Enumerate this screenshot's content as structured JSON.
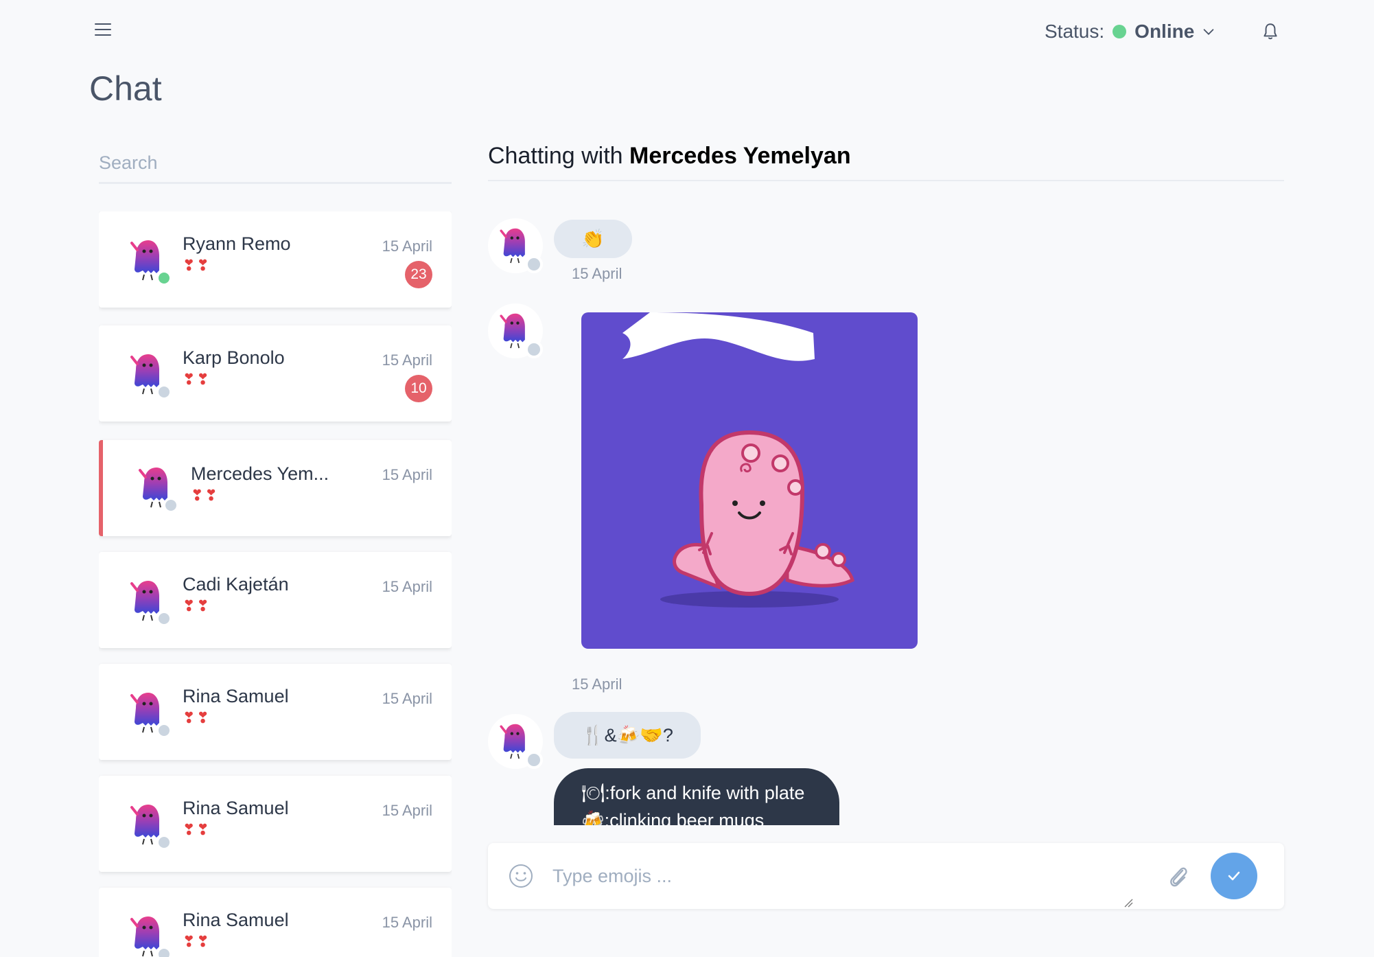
{
  "header": {
    "menu_icon": "hamburger-icon",
    "status_label": "Status:",
    "status_value": "Online",
    "status_color": "#68d391",
    "bell_icon": "bell-icon"
  },
  "page": {
    "title": "Chat"
  },
  "search": {
    "placeholder": "Search"
  },
  "contacts": [
    {
      "name": "Ryann Remo",
      "preview": "❣❣",
      "date": "15 April",
      "unread": "23",
      "online": true
    },
    {
      "name": "Karp Bonolo",
      "preview": "❣❣",
      "date": "15 April",
      "unread": "10",
      "online": false
    },
    {
      "name": "Mercedes Yem...",
      "preview": "❣❣",
      "date": "15 April",
      "active": true,
      "online": false
    },
    {
      "name": "Cadi Kajetán",
      "preview": "❣❣",
      "date": "15 April",
      "online": false
    },
    {
      "name": "Rina Samuel",
      "preview": "❣❣",
      "date": "15 April",
      "online": false
    },
    {
      "name": "Rina Samuel",
      "preview": "❣❣",
      "date": "15 April",
      "online": false
    },
    {
      "name": "Rina Samuel",
      "preview": "❣❣",
      "date": "15 April",
      "online": false
    }
  ],
  "chat": {
    "heading_prefix": "Chatting with",
    "heading_name": "Mercedes Yemelyan",
    "messages": [
      {
        "type": "emoji",
        "text": "👏",
        "date": "15 April"
      },
      {
        "type": "sticker",
        "sticker": "pink-dinosaur-sticker",
        "date": "15 April"
      },
      {
        "type": "emoji",
        "text": "🍴&🍻🤝?"
      },
      {
        "type": "translation",
        "lines": [
          "🍽:fork and knife with plate",
          "🍻:clinking beer mugs"
        ]
      }
    ]
  },
  "composer": {
    "placeholder": "Type emojis ...",
    "emoji_icon": "smiley-icon",
    "attach_icon": "paperclip-icon",
    "send_icon": "checkmark-icon",
    "send_color": "#63a4e8"
  },
  "colors": {
    "accent": "#e5626a",
    "badge": "#e5626a",
    "background": "#f8f9fb",
    "sticker_bg": "#604ccd"
  }
}
